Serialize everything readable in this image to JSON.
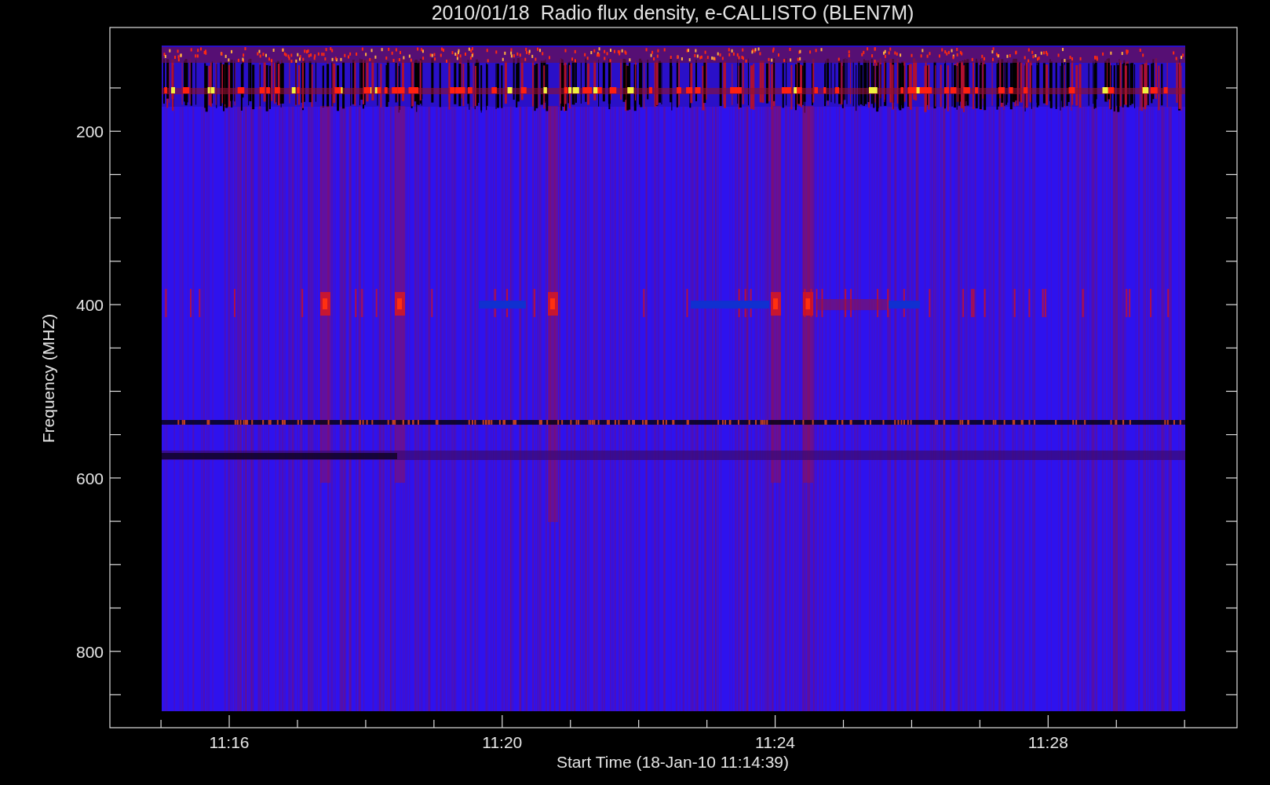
{
  "plot": {
    "title": "2010/01/18  Radio flux density, e-CALLISTO (BLEN7M)",
    "y_axis": {
      "label": "Frequency (MHZ)",
      "tick_labels": [
        "200",
        "400",
        "600",
        "800"
      ]
    },
    "x_axis": {
      "label": "Start Time (18-Jan-10 11:14:39)",
      "tick_labels": [
        "11:16",
        "11:20",
        "11:24",
        "11:28"
      ]
    }
  }
}
